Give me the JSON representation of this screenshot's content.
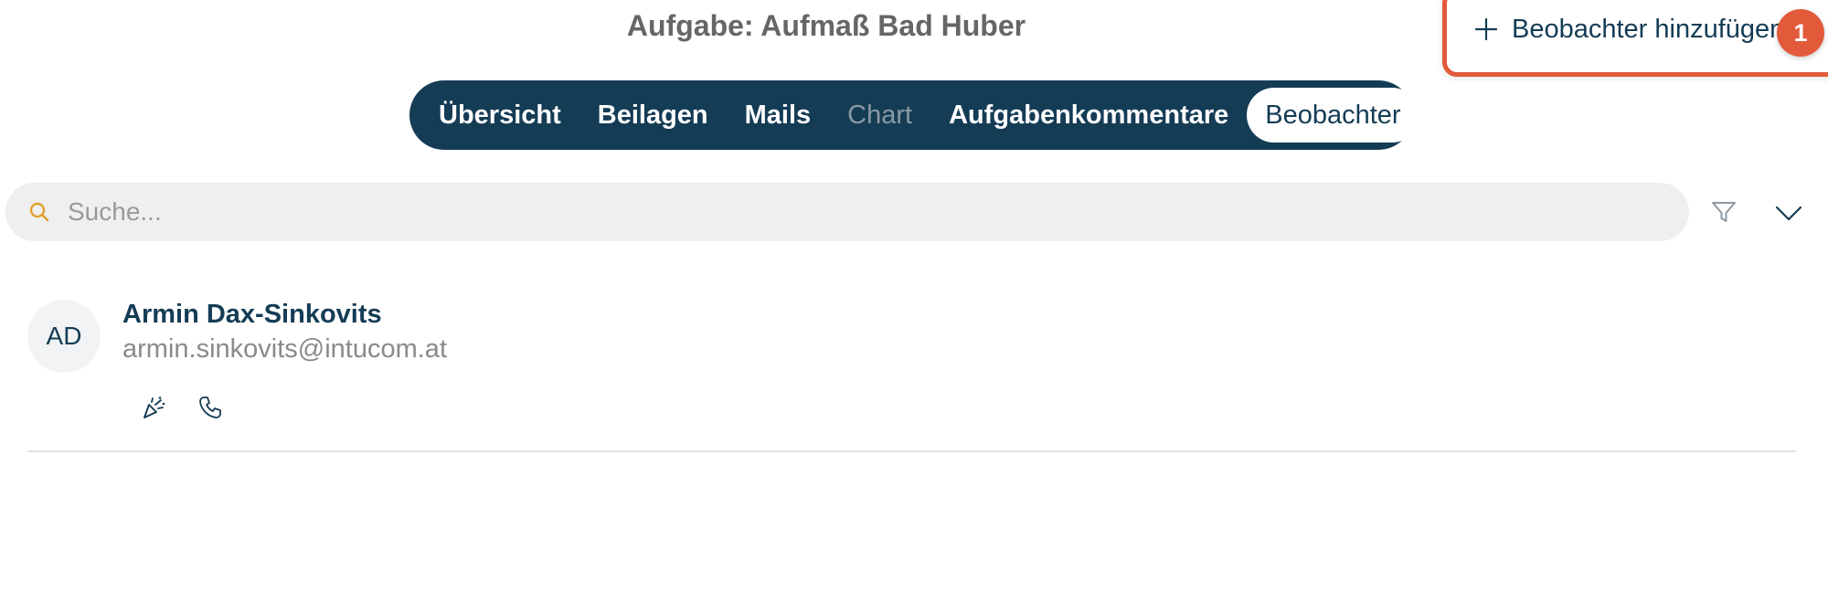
{
  "header": {
    "title": "Aufgabe: Aufmaß Bad Huber",
    "add_observer_label": "Beobachter hinzufügen",
    "step_badge": "1"
  },
  "tabs": [
    {
      "label": "Übersicht",
      "state": "normal"
    },
    {
      "label": "Beilagen",
      "state": "normal"
    },
    {
      "label": "Mails",
      "state": "normal"
    },
    {
      "label": "Chart",
      "state": "disabled"
    },
    {
      "label": "Aufgabenkommentare",
      "state": "normal"
    },
    {
      "label": "Beobachter",
      "state": "active"
    }
  ],
  "search": {
    "placeholder": "Suche...",
    "value": ""
  },
  "observers": [
    {
      "initials": "AD",
      "name": "Armin Dax-Sinkovits",
      "email": "armin.sinkovits@intucom.at",
      "actions": [
        "party-popper-icon",
        "phone-icon"
      ]
    }
  ],
  "colors": {
    "primary": "#143c55",
    "highlight": "#e35a3a",
    "search_icon": "#e0a030",
    "muted_text": "#8a8a8a"
  }
}
